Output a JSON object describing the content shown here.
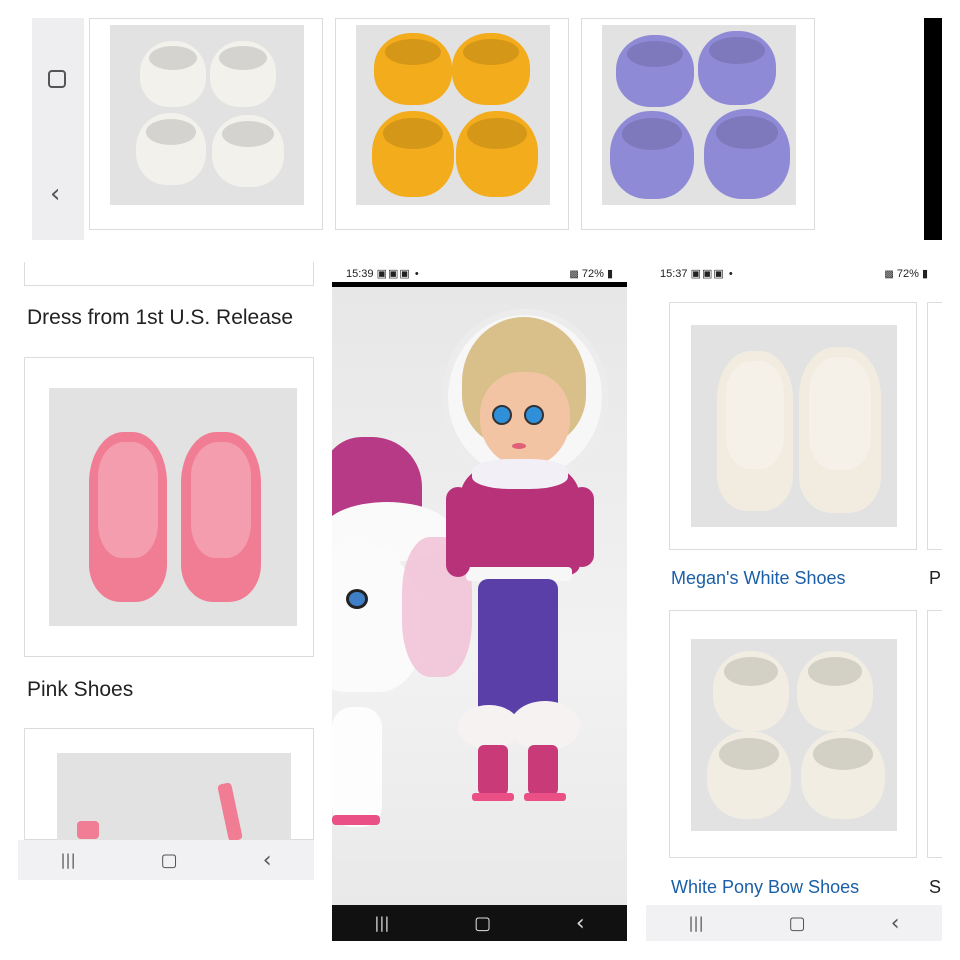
{
  "top_panel": {
    "nav": {
      "recent_icon": "square-icon",
      "back_icon": "chevron-left-icon"
    },
    "products": [
      {
        "name": "white bowl shoes",
        "color": "#f3f1ec"
      },
      {
        "name": "yellow bowl shoes",
        "color": "#f3ac1c"
      },
      {
        "name": "lavender bowl shoes",
        "color": "#8f8ad6"
      }
    ]
  },
  "left_panel": {
    "caption_top": "Dress from 1st U.S. Release",
    "pink_shoes": {
      "caption": "Pink Shoes",
      "color": "#f07d93"
    },
    "nav": {
      "recents_icon": "recents-icon",
      "home_icon": "home-icon",
      "back_icon": "back-icon"
    }
  },
  "center_panel": {
    "status_bar": {
      "time": "15:39",
      "battery": "72%"
    },
    "nav": {
      "recents_icon": "recents-icon",
      "home_icon": "home-icon",
      "back_icon": "back-icon"
    }
  },
  "right_panel": {
    "status_bar": {
      "time": "15:37",
      "battery": "72%"
    },
    "items": [
      {
        "caption": "Megan's White Shoes",
        "color": "#f2ece0"
      },
      {
        "caption": "White Pony Bow Shoes",
        "color": "#f1ede2"
      }
    ],
    "peek_captions": [
      "P",
      "S"
    ],
    "nav": {
      "recents_icon": "recents-icon",
      "home_icon": "home-icon",
      "back_icon": "back-icon"
    }
  },
  "nav_glyphs": {
    "recents": "|||",
    "home": "▢",
    "back": "‹"
  },
  "colors": {
    "link_blue": "#1a5fa8",
    "jacket_magenta": "#b8327a",
    "pants_purple": "#5a3fa8",
    "skate_pink": "#ea4f86"
  }
}
